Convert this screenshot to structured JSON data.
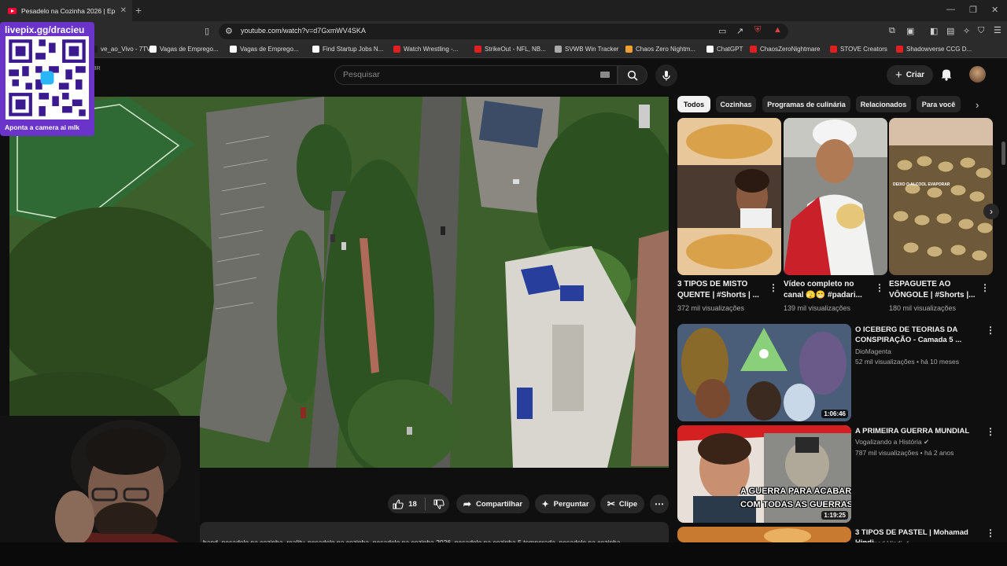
{
  "browser": {
    "tab_title": "Pesadelo na Cozinha 2026 | Ep: 3",
    "url": "youtube.com/watch?v=d7GxmWV4SKA",
    "bookmarks": [
      {
        "label": "ve_ao_Vivo - 7TV",
        "color": "#1f1f1f"
      },
      {
        "label": "Vagas de Emprego...",
        "color": "#ffffff"
      },
      {
        "label": "Vagas de Emprego...",
        "color": "#ffffff"
      },
      {
        "label": "Find Startup Jobs N...",
        "color": "#ffffff"
      },
      {
        "label": "Watch Wrestling -...",
        "color": "#e02020"
      },
      {
        "label": "StrikeOut - NFL, NB...",
        "color": "#e02020"
      },
      {
        "label": "SVWB Win Tracker",
        "color": "#aaaaaa"
      },
      {
        "label": "Chaos Zero Nightm...",
        "color": "#f0a030"
      },
      {
        "label": "ChatGPT",
        "color": "#ffffff"
      },
      {
        "label": "ChaosZeroNightmare",
        "color": "#e02020"
      },
      {
        "label": "STOVE Creators",
        "color": "#e02020"
      },
      {
        "label": "Shadowverse CCG D...",
        "color": "#e02020"
      }
    ]
  },
  "header": {
    "search_placeholder": "Pesquisar",
    "create_label": "Criar",
    "logo_fragment": "BR"
  },
  "overlay": {
    "qr_title": "livepix.gg/dracieu",
    "qr_caption": "Aponta a camera ai mlk"
  },
  "actions": {
    "like_count": "18",
    "share_label": "Compartilhar",
    "ask_label": "Perguntar",
    "clip_label": "Clipe"
  },
  "description_text": "band, pesadelo na cozinha, reality, pesadelo na cozinha, pesadelo na cozinha 2026, pesadelo na cozinha 5 temporada, pesadelo na cozinha",
  "chips": [
    "Todos",
    "Cozinhas",
    "Programas de culinária",
    "Relacionados",
    "Para você"
  ],
  "shorts": [
    {
      "title": "3 TIPOS DE MISTO QUENTE | #Shorts | ...",
      "views": "372 mil visualizações"
    },
    {
      "title": "Vídeo completo no canal 🫣😁 #padari...",
      "views": "139 mil visualizações"
    },
    {
      "title": "ESPAGUETE AO VÔNGOLE | #Shorts |...",
      "views": "180 mil visualizações",
      "overlay_text": "DEIXO O ALCOOL EVAPORAR"
    }
  ],
  "videos": [
    {
      "title": "O ICEBERG DE TEORIAS DA CONSPIRAÇÃO - Camada 5 ...",
      "channel": "DioMagenta",
      "meta": "52 mil visualizações • há 10 meses",
      "duration": "1:06:46"
    },
    {
      "title": "A PRIMEIRA GUERRA MUNDIAL",
      "channel": "Vogalizando a História ✔",
      "meta": "787 mil visualizações • há 2 anos",
      "duration": "1:19:25",
      "thumb_text_1": "A GUERRA PARA ACABAR",
      "thumb_text_2": "COM TODAS AS GUERRAS"
    },
    {
      "title": "3 TIPOS DE PASTEL | Mohamad Hindi",
      "channel": "Mohamad Hindi ✔",
      "meta": "",
      "duration": ""
    }
  ]
}
